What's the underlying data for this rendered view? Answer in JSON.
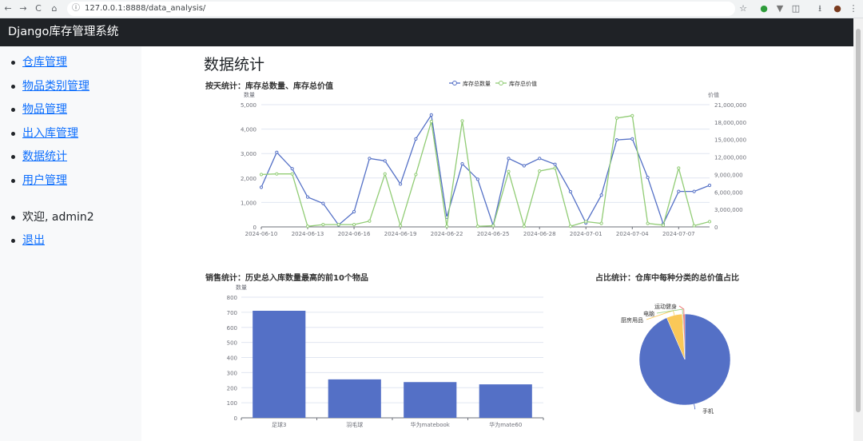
{
  "browser": {
    "url": "127.0.0.1:8888/data_analysis/",
    "back_glyph": "←",
    "forward_glyph": "→",
    "reload_glyph": "C",
    "home_glyph": "⌂",
    "star_glyph": "☆",
    "menu_glyph": "⋮"
  },
  "app": {
    "title": "Django库存管理系统"
  },
  "sidebar": {
    "items": [
      {
        "label": "仓库管理"
      },
      {
        "label": "物品类别管理"
      },
      {
        "label": "物品管理"
      },
      {
        "label": "出入库管理"
      },
      {
        "label": "数据统计"
      },
      {
        "label": "用户管理"
      }
    ],
    "welcome": "欢迎, admin2",
    "logout": "退出"
  },
  "main": {
    "title": "数据统计"
  },
  "colors": {
    "blue": "#5470c6",
    "green": "#91cc75",
    "yellow": "#fac858",
    "red": "#ee6666"
  },
  "chart_data": [
    {
      "type": "line",
      "title": "按天统计：库存总数量、库存总价值",
      "legend": [
        "库存总数量",
        "库存总价值"
      ],
      "legend_position": "top-center",
      "ylabel_left": "数量",
      "ylabel_right": "价值",
      "ylim_left": [
        0,
        5000
      ],
      "ylim_right": [
        0,
        21000000
      ],
      "yticks_left": [
        "0",
        "1,000",
        "2,000",
        "3,000",
        "4,000",
        "5,000"
      ],
      "yticks_right": [
        "0",
        "3,000,000",
        "6,000,000",
        "9,000,000",
        "12,000,000",
        "15,000,000",
        "18,000,000",
        "21,000,000"
      ],
      "xtick_labels": [
        "2024-06-10",
        "2024-06-13",
        "2024-06-16",
        "2024-06-19",
        "2024-06-22",
        "2024-06-25",
        "2024-06-28",
        "2024-07-01",
        "2024-07-04",
        "2024-07-07"
      ],
      "x": [
        "2024-06-10",
        "2024-06-11",
        "2024-06-12",
        "2024-06-13",
        "2024-06-14",
        "2024-06-15",
        "2024-06-16",
        "2024-06-17",
        "2024-06-18",
        "2024-06-19",
        "2024-06-20",
        "2024-06-21",
        "2024-06-22",
        "2024-06-23",
        "2024-06-24",
        "2024-06-25",
        "2024-06-26",
        "2024-06-27",
        "2024-06-28",
        "2024-06-29",
        "2024-06-30",
        "2024-07-01",
        "2024-07-02",
        "2024-07-03",
        "2024-07-04",
        "2024-07-05",
        "2024-07-06",
        "2024-07-07",
        "2024-07-08",
        "2024-07-09"
      ],
      "grid": true,
      "series": [
        {
          "name": "库存总数量",
          "axis": "left",
          "values": [
            1620,
            3050,
            2380,
            1220,
            960,
            80,
            620,
            2800,
            2700,
            1750,
            3600,
            4580,
            400,
            2580,
            1950,
            60,
            2800,
            2500,
            2800,
            2560,
            1440,
            160,
            1300,
            3560,
            3600,
            2020,
            120,
            1450,
            1450,
            1700
          ]
        },
        {
          "name": "库存总价值",
          "axis": "right",
          "values": [
            9000000,
            9100000,
            9100000,
            100000,
            400000,
            400000,
            400000,
            1000000,
            9100000,
            200000,
            9000000,
            18100000,
            100000,
            18200000,
            100000,
            200000,
            9500000,
            100000,
            9600000,
            10100000,
            100000,
            900000,
            600000,
            18700000,
            19100000,
            600000,
            300000,
            10100000,
            200000,
            900000
          ]
        }
      ]
    },
    {
      "type": "bar",
      "title": "销售统计：历史总入库数量最高的前10个物品",
      "ylabel": "数量",
      "ylim": [
        0,
        800
      ],
      "yticks": [
        "0",
        "100",
        "200",
        "300",
        "400",
        "500",
        "600",
        "700",
        "800"
      ],
      "categories": [
        "足球3",
        "羽毛球",
        "华为matebook",
        "华为mate60"
      ],
      "values": [
        710,
        255,
        237,
        222
      ],
      "grid": true
    },
    {
      "type": "pie",
      "title": "占比统计：仓库中每种分类的总价值占比",
      "labels": [
        "手机",
        "厨房用品",
        "电脑",
        "运动健身"
      ],
      "values": [
        93.5,
        5.6,
        0.3,
        0.6
      ]
    }
  ]
}
